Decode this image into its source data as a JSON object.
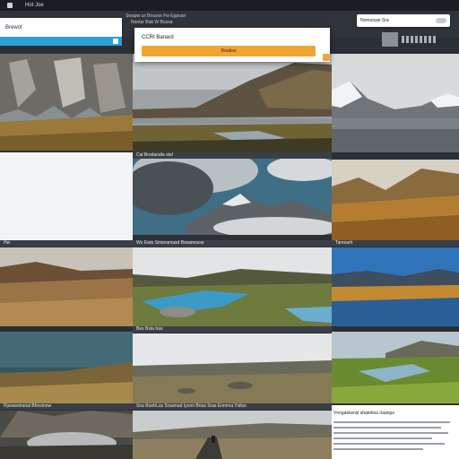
{
  "browser": {
    "tab_label": "Hot Joe"
  },
  "header_strip": {
    "texts": [
      "Swapw us Bnasos  Fw Eppsan",
      "Nontar Bak W Bussa"
    ]
  },
  "left_panel": {
    "title": "Brewof"
  },
  "dialog": {
    "title": "CCRI Banard",
    "button_label": "Reatiso"
  },
  "right_panel": {
    "label": "Nomoisan Sra"
  },
  "captions": {
    "row2_left": "",
    "row2_mid": "Cal Brodaralla stel",
    "row3_left": "Hw",
    "row3_mid": "Ws Ewis Smsnamasd Bssamosse",
    "row3_right": "Tamearh",
    "row4_mid": "Bes Bsta bas",
    "row5_left": "Ppeswstranal Bhnsinnw",
    "row5_mid": "Sna BoebLus Srsamad Iyonn Bnsa Sras Enmma Ysilos"
  },
  "text_tile": {
    "title": "Vnngaelwnsl shatetioa rlaanps"
  },
  "colors": {
    "accent_orange": "#f0a535",
    "accent_blue": "#2a9fd6",
    "background": "#2b2f36"
  }
}
